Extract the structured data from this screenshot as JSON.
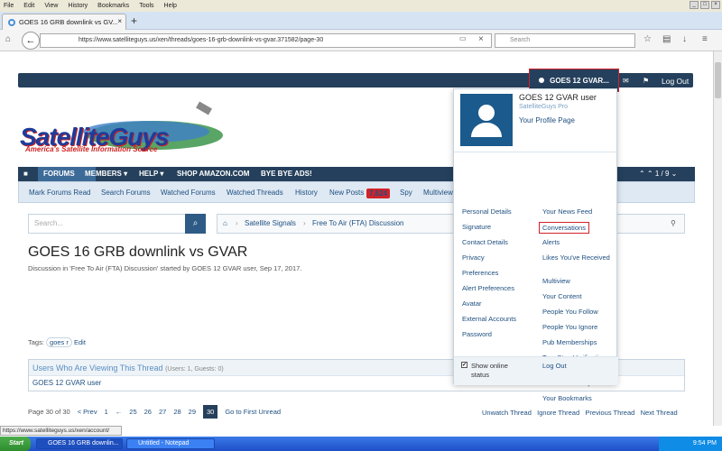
{
  "browser": {
    "menu": [
      "File",
      "Edit",
      "View",
      "History",
      "Bookmarks",
      "Tools",
      "Help"
    ],
    "tab_title": "GOES 16 GRB downlink vs GV...",
    "url": "https://www.satelliteguys.us/xen/threads/goes-16-grb-downlink-vs-gvar.371582/page-30",
    "search_placeholder": "Search"
  },
  "userbar": {
    "account": "GOES 12 GVAR...",
    "logout": "Log Out"
  },
  "logo": {
    "word": "SatelliteGuys",
    "tagline": "America's Satellite Information Source"
  },
  "mainnav": {
    "items": [
      "FORUMS",
      "MEMBERS ▾",
      "HELP ▾",
      "SHOP AMAZON.COM",
      "BYE BYE ADS!"
    ],
    "pager": "1 / 9"
  },
  "subnav": {
    "items": [
      "Mark Forums Read",
      "Search Forums",
      "Watched Forums",
      "Watched Threads",
      "History",
      "New Posts",
      "Spy",
      "Multiview"
    ],
    "newposts_badge": "7,624"
  },
  "search": {
    "placeholder": "Search..."
  },
  "breadcrumb": [
    "Satellite Signals",
    "Free To Air (FTA) Discussion"
  ],
  "thread": {
    "title": "GOES 16 GRB downlink vs GVAR",
    "meta": "Discussion in 'Free To Air (FTA) Discussion' started by GOES 12 GVAR user, Sep 17, 2017.",
    "tags_label": "Tags:",
    "tag": "goes r",
    "tag_edit": "Edit"
  },
  "viewing": {
    "title": "Users Who Are Viewing This Thread",
    "counts": "(Users: 1, Guests: 0)",
    "user": "GOES 12 GVAR user"
  },
  "pager": {
    "label": "Page 30 of 30",
    "prev": "< Prev",
    "pages": [
      "1",
      "←",
      "25",
      "26",
      "27",
      "28",
      "29"
    ],
    "current": "30",
    "first_unread": "Go to First Unread"
  },
  "thread_actions": [
    "Unwatch Thread",
    "Ignore Thread",
    "Previous Thread",
    "Next Thread"
  ],
  "dropdown": {
    "name": "GOES 12 GVAR user",
    "role": "SatelliteGuys Pro",
    "profile": "Your Profile Page",
    "left": [
      "Personal Details",
      "Signature",
      "Contact Details",
      "Privacy",
      "Preferences",
      "Alert Preferences",
      "Avatar",
      "External Accounts",
      "Password"
    ],
    "right": [
      "Your News Feed",
      "Conversations",
      "Alerts",
      "Likes You've Received",
      "Multiview",
      "Your Content",
      "People You Follow",
      "People You Ignore",
      "Pub Memberships",
      "Two-Step Verification",
      "Join User Groups",
      "Your Bookmarks"
    ],
    "show_online": "Show online status",
    "logout": "Log Out"
  },
  "status_url": "https://www.satelliteguys.us/xen/account/",
  "taskbar": {
    "start": "Start",
    "tasks": [
      "GOES 16 GRB downlin...",
      "Untitled - Notepad"
    ],
    "clock": "9:54 PM"
  }
}
